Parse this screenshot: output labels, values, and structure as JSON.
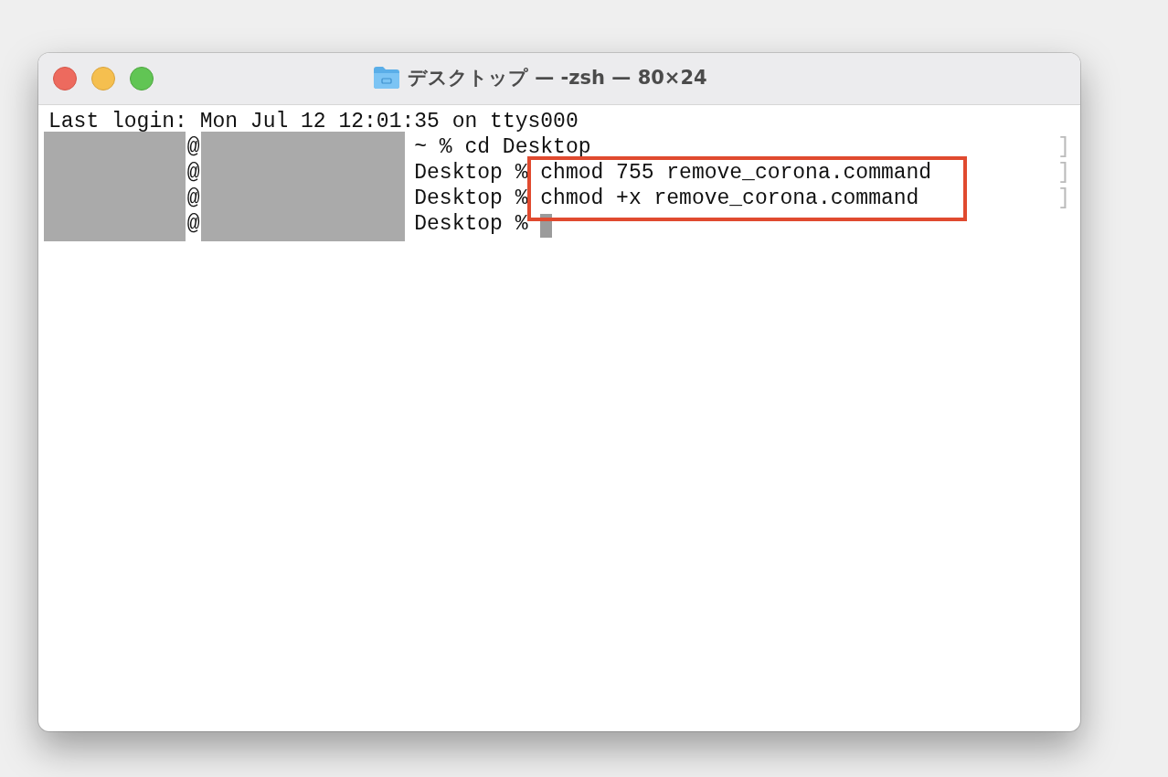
{
  "window": {
    "title": "デスクトップ — -zsh — 80×24"
  },
  "terminal": {
    "lines": [
      {
        "kind": "text",
        "text": "Last login: Mon Jul 12 12:01:35 on ttys000"
      },
      {
        "kind": "prompt",
        "at": "@",
        "command": "~ % cd Desktop",
        "edge": "]"
      },
      {
        "kind": "prompt",
        "at": "@",
        "command": "Desktop % chmod 755 remove_corona.command",
        "edge": "]",
        "highlighted": true
      },
      {
        "kind": "prompt",
        "at": "@",
        "command": "Desktop % chmod +x remove_corona.command",
        "edge": "]",
        "highlighted": true
      },
      {
        "kind": "prompt",
        "at": "@",
        "command": "Desktop % ",
        "cursor": true
      }
    ]
  }
}
